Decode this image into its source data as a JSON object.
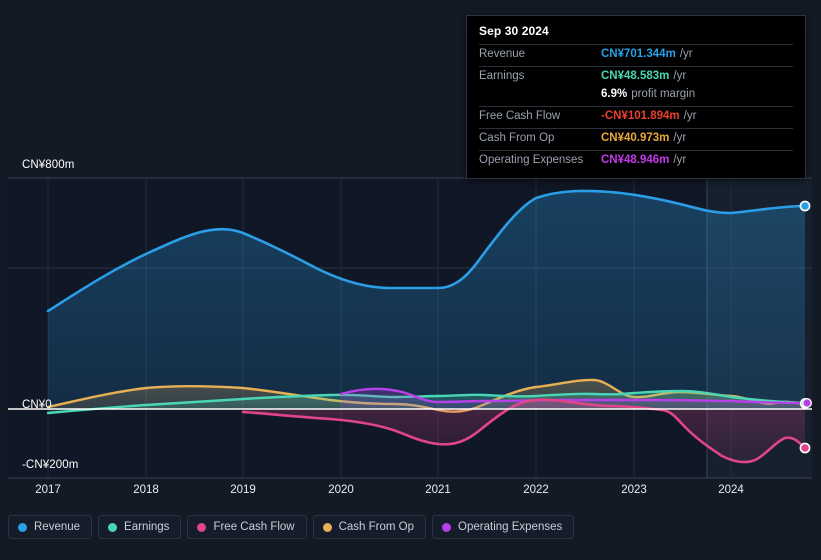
{
  "axis": {
    "y_ticks": [
      {
        "label": "CN¥800m",
        "value": 800
      },
      {
        "label": "CN¥0",
        "value": 0
      },
      {
        "label": "-CN¥200m",
        "value": -200
      }
    ],
    "x_ticks": [
      "2017",
      "2018",
      "2019",
      "2020",
      "2021",
      "2022",
      "2023",
      "2024"
    ],
    "y_min": -200,
    "y_max": 800,
    "currency": "CN¥",
    "unit": "m"
  },
  "tooltip": {
    "title": "Sep 30 2024",
    "rows": [
      {
        "label": "Revenue",
        "value": "CN¥701.344m",
        "unit": "/yr",
        "color": "#2a9fe8"
      },
      {
        "label": "Earnings",
        "value": "CN¥48.583m",
        "unit": "/yr",
        "color": "#4ad6b4"
      },
      {
        "label": "",
        "value": "6.9%",
        "unit": "profit margin",
        "color": "#ffffff",
        "sub": true
      },
      {
        "label": "Free Cash Flow",
        "value": "-CN¥101.894m",
        "unit": "/yr",
        "color": "#e8412e"
      },
      {
        "label": "Cash From Op",
        "value": "CN¥40.973m",
        "unit": "/yr",
        "color": "#e8a93c"
      },
      {
        "label": "Operating Expenses",
        "value": "CN¥48.946m",
        "unit": "/yr",
        "color": "#c23ae8"
      }
    ]
  },
  "legend": {
    "items": [
      {
        "label": "Revenue",
        "color": "#2a9fe8"
      },
      {
        "label": "Earnings",
        "color": "#4ad6b4"
      },
      {
        "label": "Free Cash Flow",
        "color": "#e0458a"
      },
      {
        "label": "Cash From Op",
        "color": "#e8b054"
      },
      {
        "label": "Operating Expenses",
        "color": "#b840e8"
      }
    ]
  },
  "chart_data": {
    "type": "area",
    "title": "",
    "xlabel": "",
    "ylabel": "CN¥ (millions)",
    "ylim": [
      -200,
      800
    ],
    "grid": true,
    "legend_position": "bottom",
    "x": [
      "2017",
      "2018",
      "2019",
      "2020",
      "2021",
      "2022",
      "2023",
      "2024",
      "Sep 30 2024"
    ],
    "forecast_start": "2023.9",
    "series": [
      {
        "name": "Revenue",
        "color": "#2a9fe8",
        "values": [
          327,
          405,
          472,
          415,
          372,
          680,
          718,
          688,
          701.344
        ],
        "points": [
          [
            2017.0,
            327
          ],
          [
            2017.5,
            368
          ],
          [
            2018.0,
            405
          ],
          [
            2018.5,
            443
          ],
          [
            2019.0,
            472
          ],
          [
            2019.4,
            470
          ],
          [
            2019.8,
            437
          ],
          [
            2020.3,
            412
          ],
          [
            2020.8,
            376
          ],
          [
            2021.0,
            372
          ],
          [
            2021.3,
            374
          ],
          [
            2021.7,
            500
          ],
          [
            2022.0,
            680
          ],
          [
            2022.4,
            712
          ],
          [
            2022.8,
            718
          ],
          [
            2023.2,
            705
          ],
          [
            2023.6,
            690
          ],
          [
            2023.9,
            680
          ],
          [
            2024.2,
            672
          ],
          [
            2024.5,
            690
          ],
          [
            2024.75,
            701.344
          ]
        ]
      },
      {
        "name": "Earnings",
        "color": "#4ad6b4",
        "values": [
          -13,
          10,
          28,
          40,
          42,
          48,
          54,
          50,
          48.583
        ],
        "points": [
          [
            2017.0,
            -13
          ],
          [
            2018.0,
            10
          ],
          [
            2019.0,
            28
          ],
          [
            2020.0,
            40
          ],
          [
            2021.0,
            42
          ],
          [
            2021.5,
            40
          ],
          [
            2022.0,
            48
          ],
          [
            2022.5,
            44
          ],
          [
            2023.0,
            54
          ],
          [
            2023.5,
            50
          ],
          [
            2024.0,
            46
          ],
          [
            2024.75,
            48.583
          ]
        ]
      },
      {
        "name": "Free Cash Flow",
        "color": "#e0458a",
        "values": [
          null,
          null,
          -15,
          -25,
          -92,
          42,
          -20,
          -150,
          -101.894
        ],
        "points": [
          [
            2019.1,
            -15
          ],
          [
            2019.6,
            -20
          ],
          [
            2020.0,
            -25
          ],
          [
            2020.4,
            -38
          ],
          [
            2020.8,
            -75
          ],
          [
            2021.1,
            -92
          ],
          [
            2021.4,
            -85
          ],
          [
            2021.8,
            -20
          ],
          [
            2022.1,
            42
          ],
          [
            2022.4,
            10
          ],
          [
            2022.8,
            5
          ],
          [
            2023.1,
            -60
          ],
          [
            2023.5,
            -95
          ],
          [
            2023.8,
            -150
          ],
          [
            2024.0,
            -175
          ],
          [
            2024.3,
            -120
          ],
          [
            2024.5,
            -130
          ],
          [
            2024.75,
            -101.894
          ]
        ]
      },
      {
        "name": "Cash From Op",
        "color": "#e8b054",
        "values": [
          8,
          45,
          72,
          48,
          18,
          78,
          60,
          42,
          40.973
        ],
        "points": [
          [
            2017.0,
            8
          ],
          [
            2017.6,
            35
          ],
          [
            2018.2,
            58
          ],
          [
            2018.9,
            72
          ],
          [
            2019.5,
            62
          ],
          [
            2020.0,
            48
          ],
          [
            2020.5,
            28
          ],
          [
            2021.0,
            18
          ],
          [
            2021.4,
            30
          ],
          [
            2021.8,
            52
          ],
          [
            2022.1,
            78
          ],
          [
            2022.4,
            48
          ],
          [
            2022.8,
            62
          ],
          [
            2023.2,
            56
          ],
          [
            2023.6,
            60
          ],
          [
            2023.9,
            58
          ],
          [
            2024.2,
            30
          ],
          [
            2024.5,
            50
          ],
          [
            2024.75,
            40.973
          ]
        ]
      },
      {
        "name": "Operating Expenses",
        "color": "#b840e8",
        "values": [
          null,
          null,
          null,
          52,
          40,
          44,
          46,
          48,
          48.946
        ],
        "points": [
          [
            2020.0,
            52
          ],
          [
            2020.4,
            62
          ],
          [
            2020.8,
            60
          ],
          [
            2021.0,
            40
          ],
          [
            2021.6,
            42
          ],
          [
            2022.2,
            44
          ],
          [
            2022.8,
            45
          ],
          [
            2023.4,
            46
          ],
          [
            2024.0,
            47
          ],
          [
            2024.75,
            48.946
          ]
        ]
      }
    ]
  }
}
